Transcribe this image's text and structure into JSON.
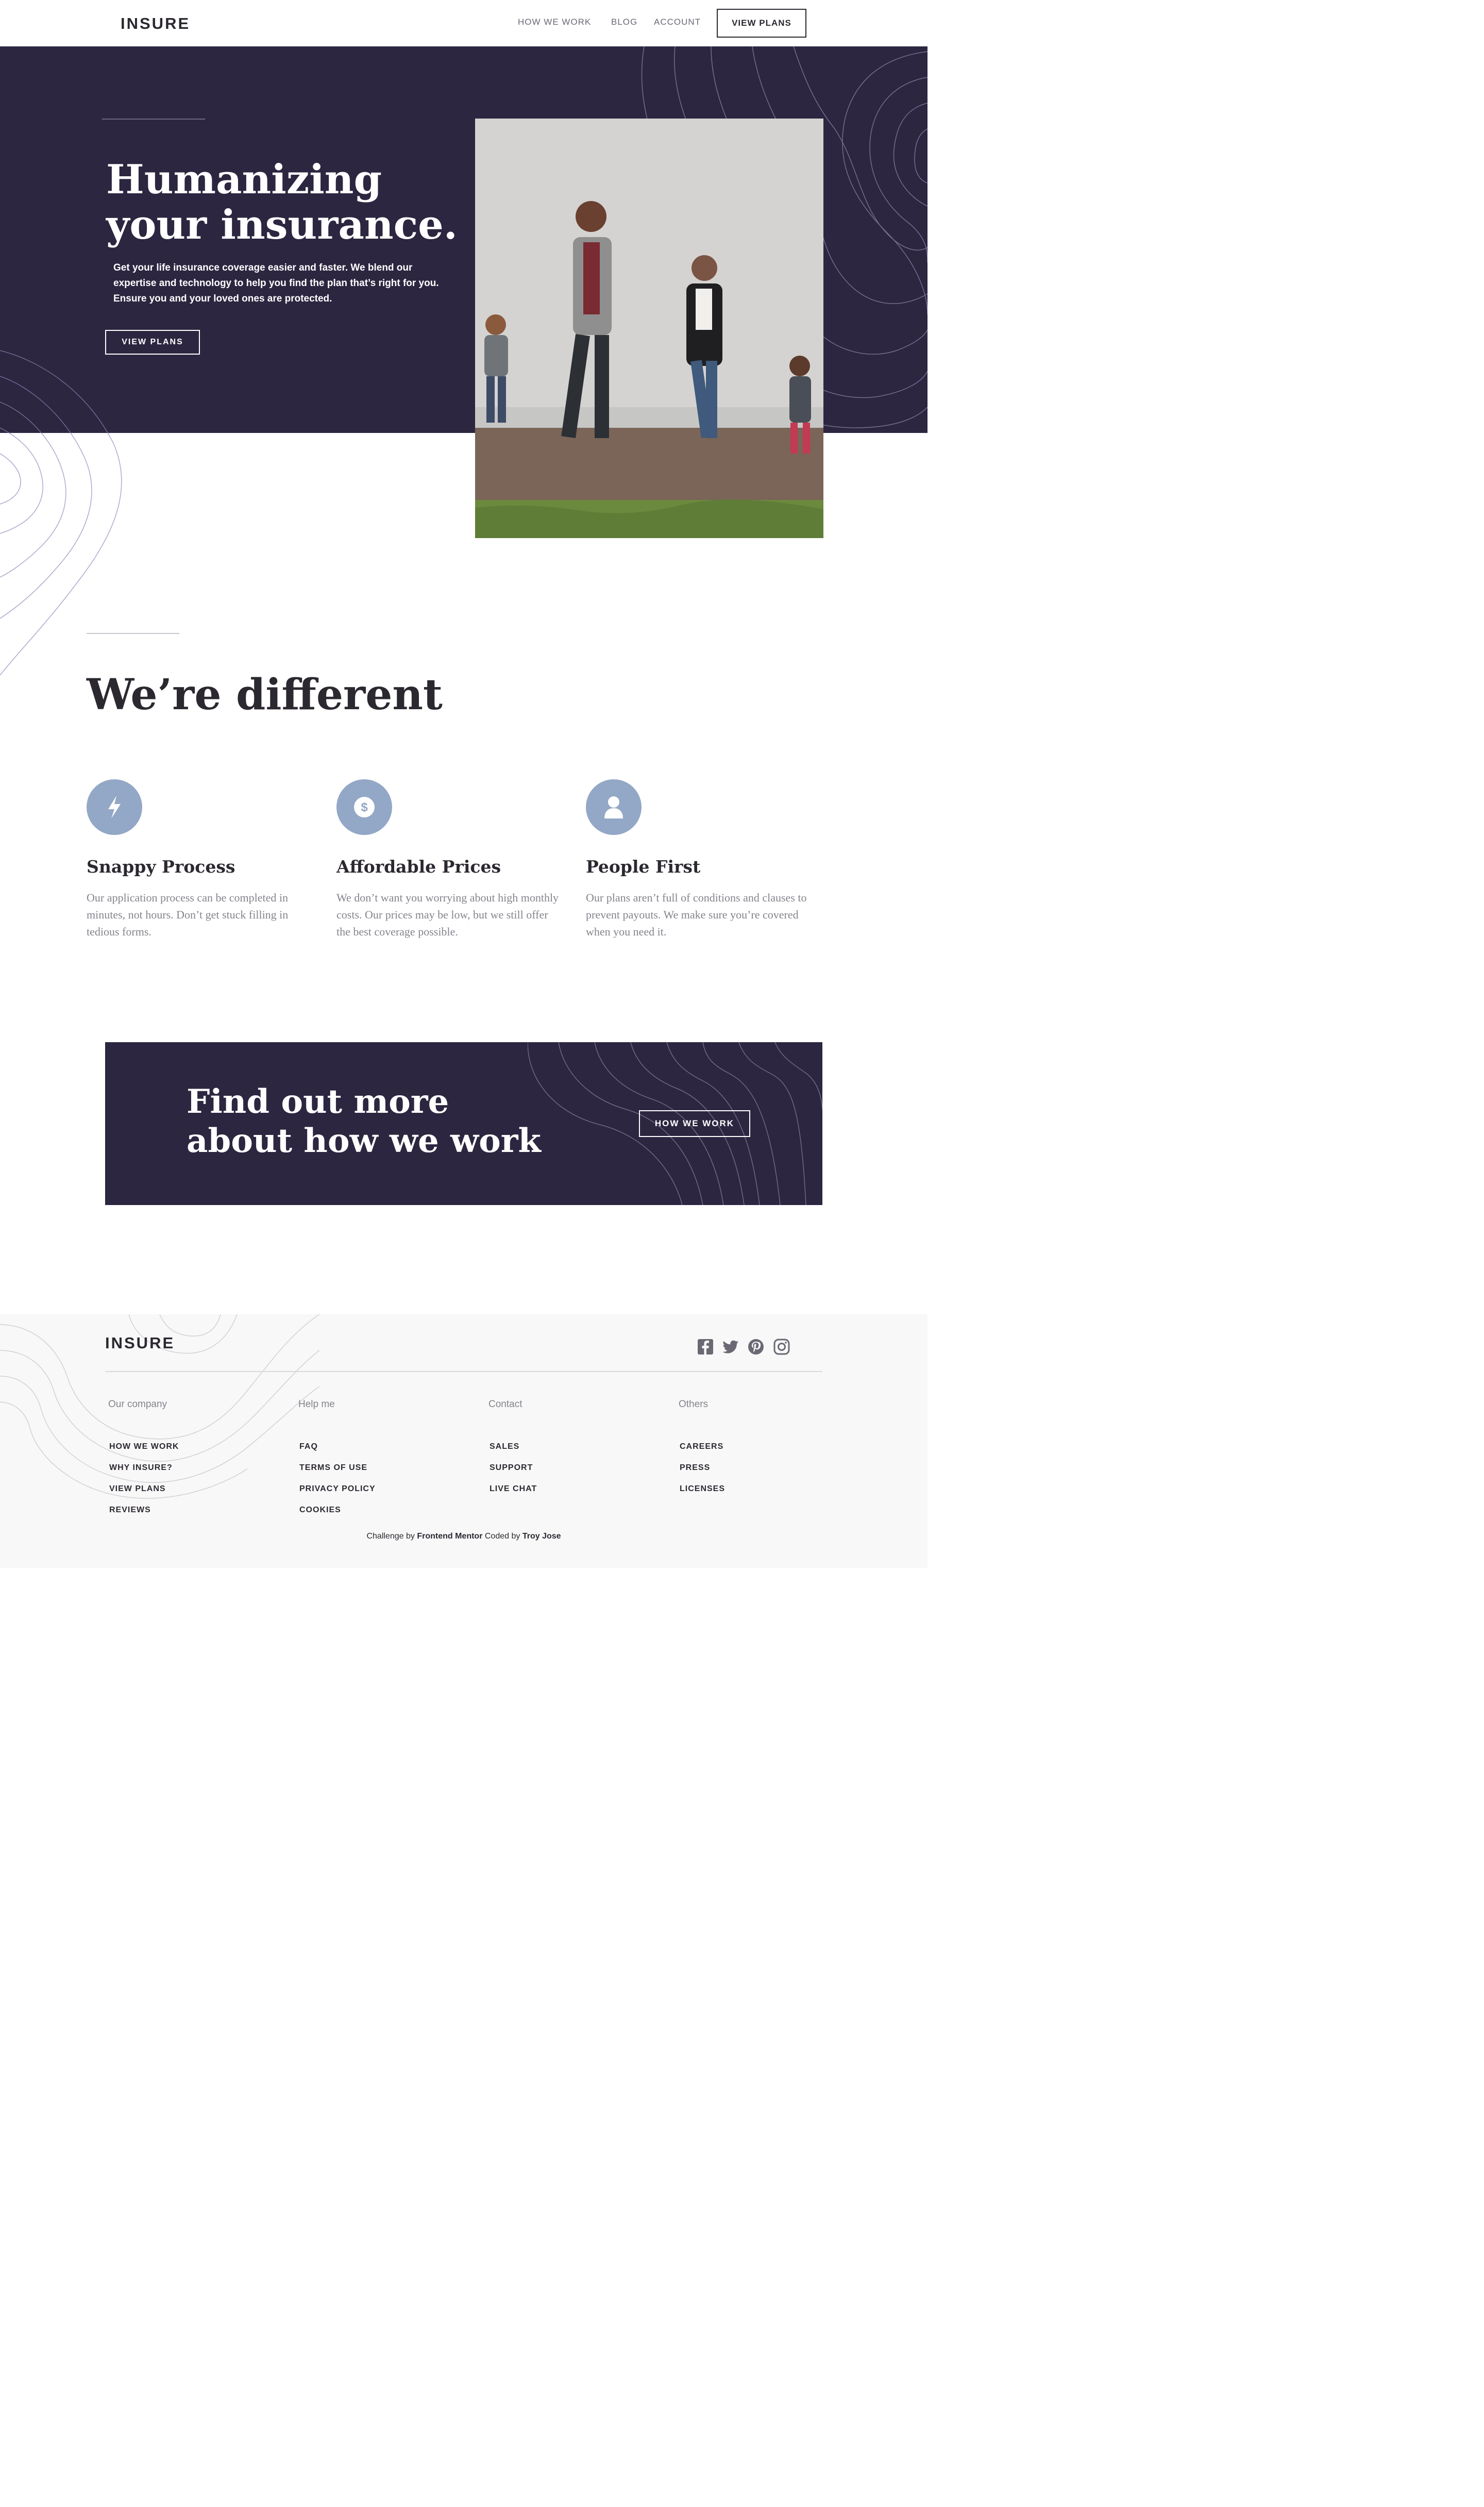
{
  "header": {
    "logo": "INSURE",
    "nav": [
      "HOW WE WORK",
      "BLOG",
      "ACCOUNT"
    ],
    "cta": "VIEW PLANS"
  },
  "hero": {
    "title_line1": "Humanizing",
    "title_line2": "your insurance.",
    "text": "Get your life insurance coverage easier and faster. We blend our expertise and technology to help you find the plan that’s right for you. Ensure you and your loved ones are protected.",
    "button": "VIEW PLANS"
  },
  "different": {
    "title": "We’re different",
    "features": [
      {
        "icon": "lightning-icon",
        "title": "Snappy Process",
        "text": "Our application process can be completed in minutes, not hours. Don’t get stuck filling in tedious forms."
      },
      {
        "icon": "dollar-icon",
        "title": "Affordable Prices",
        "text": "We don’t want you worrying about high monthly costs. Our prices may be low, but we still offer the best coverage possible."
      },
      {
        "icon": "person-icon",
        "title": "People First",
        "text": "Our plans aren’t full of conditions and clauses to prevent payouts. We make sure you’re covered when you need it."
      }
    ]
  },
  "cta": {
    "title_line1": "Find out more",
    "title_line2": "about how we work",
    "button": "HOW WE WORK"
  },
  "footer": {
    "logo": "INSURE",
    "social": [
      "facebook-icon",
      "twitter-icon",
      "pinterest-icon",
      "instagram-icon"
    ],
    "columns": [
      {
        "heading": "Our company",
        "links": [
          "HOW WE WORK",
          "WHY INSURE?",
          "VIEW PLANS",
          "REVIEWS"
        ]
      },
      {
        "heading": "Help me",
        "links": [
          "FAQ",
          "TERMS OF USE",
          "PRIVACY POLICY",
          "COOKIES"
        ]
      },
      {
        "heading": "Contact",
        "links": [
          "SALES",
          "SUPPORT",
          "LIVE CHAT"
        ]
      },
      {
        "heading": "Others",
        "links": [
          "CAREERS",
          "PRESS",
          "LICENSES"
        ]
      }
    ],
    "credit_prefix": "Challenge by",
    "credit_link1": "Frontend Mentor",
    "credit_mid": "Coded by",
    "credit_link2": "Troy Jose"
  },
  "colors": {
    "dark_violet": "#2c2640",
    "icon_blue": "#93a7c6",
    "text_dark": "#2c2830",
    "text_grey": "#85838c"
  }
}
